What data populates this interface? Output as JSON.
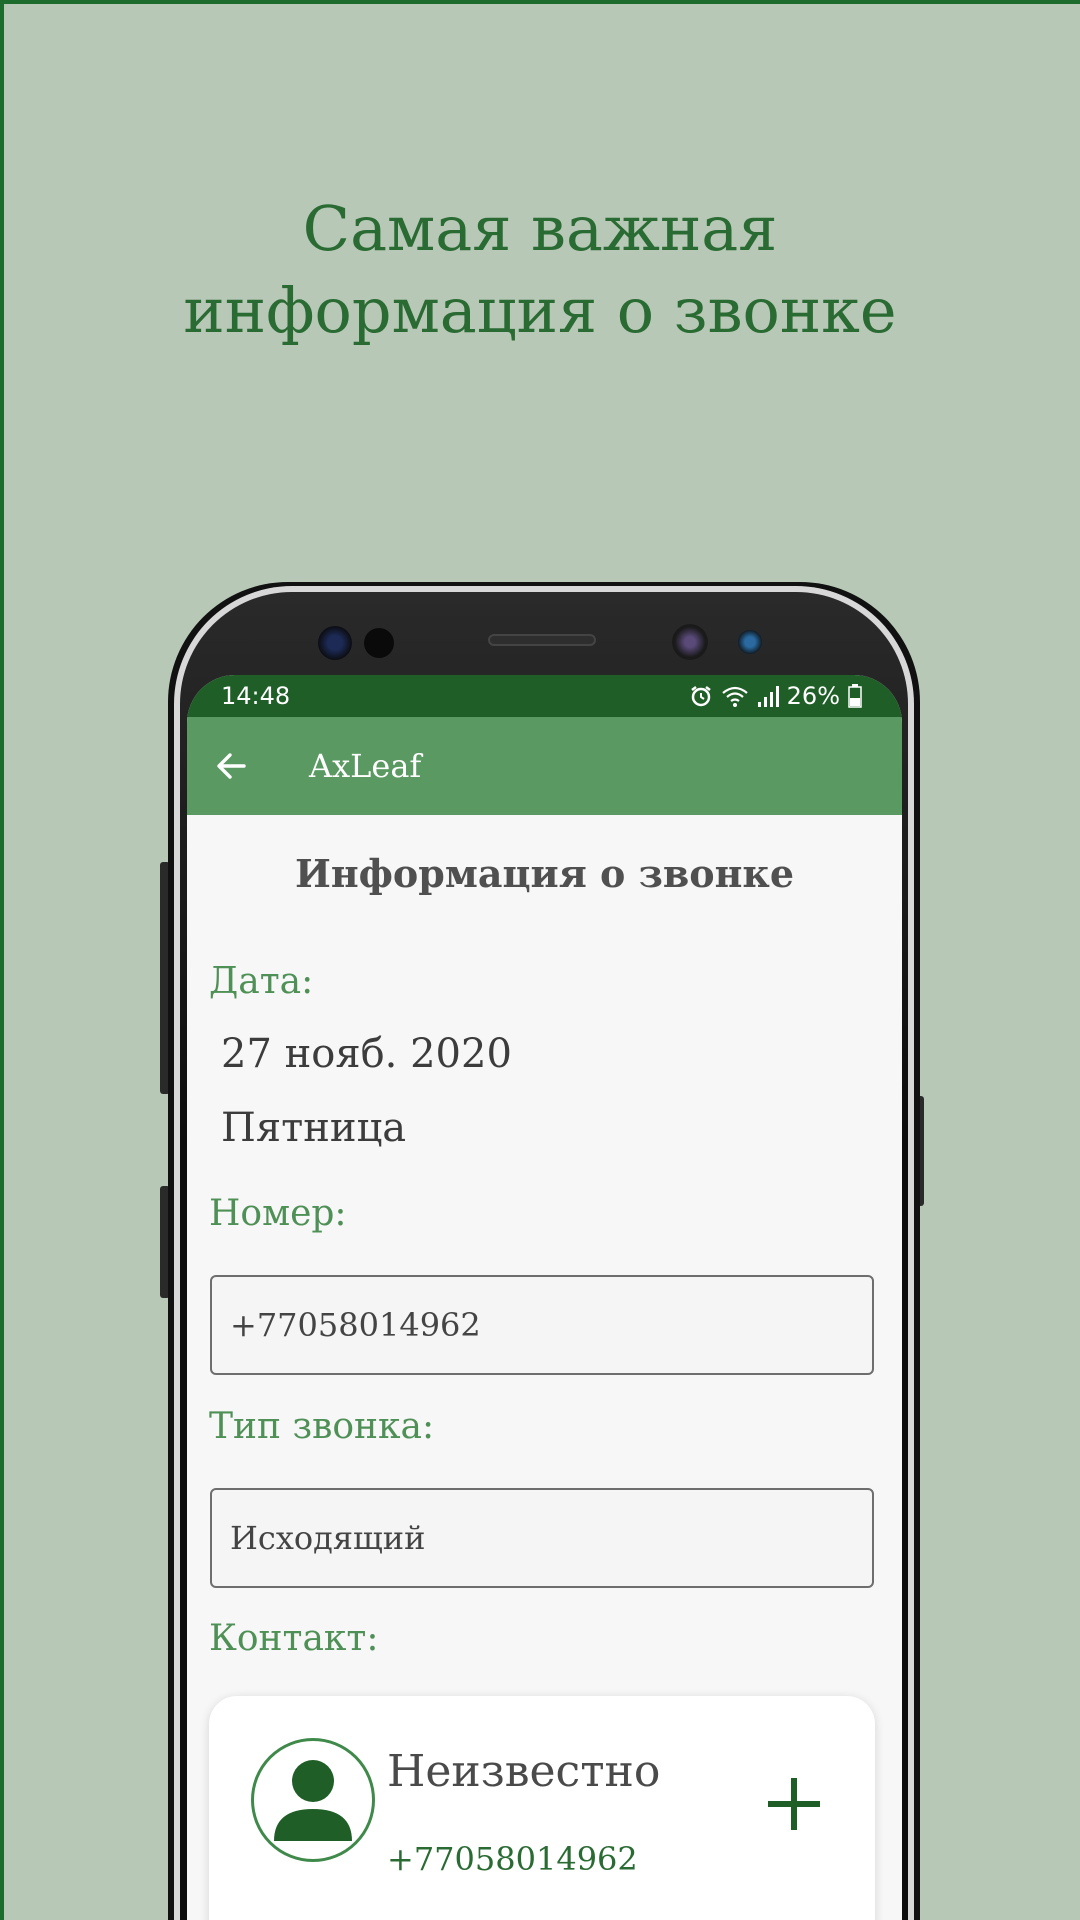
{
  "headline": {
    "line1": "Самая важная",
    "line2": "информация о звонке"
  },
  "status_bar": {
    "time": "14:48",
    "battery": "26%",
    "icons": [
      "alarm-icon",
      "wifi-icon",
      "signal-icon",
      "battery-icon"
    ]
  },
  "app_bar": {
    "title": "AxLeaf",
    "back_icon": "arrow-left-icon"
  },
  "page": {
    "title": "Информация о звонке",
    "date_label": "Дата:",
    "date_value": "27 нояб. 2020",
    "weekday_value": "Пятница",
    "number_label": "Номер:",
    "number_value": "+77058014962",
    "call_type_label": "Тип звонка:",
    "call_type_value": "Исходящий",
    "contact_label": "Контакт:"
  },
  "contact": {
    "name": "Неизвестно",
    "phone": "+77058014962",
    "avatar_icon": "person-icon",
    "add_icon": "plus-icon"
  },
  "colors": {
    "background": "#b7c9b6",
    "headline": "#2a6b33",
    "status_bar": "#1f5e27",
    "app_bar": "#5a9962",
    "label": "#4f9057"
  }
}
